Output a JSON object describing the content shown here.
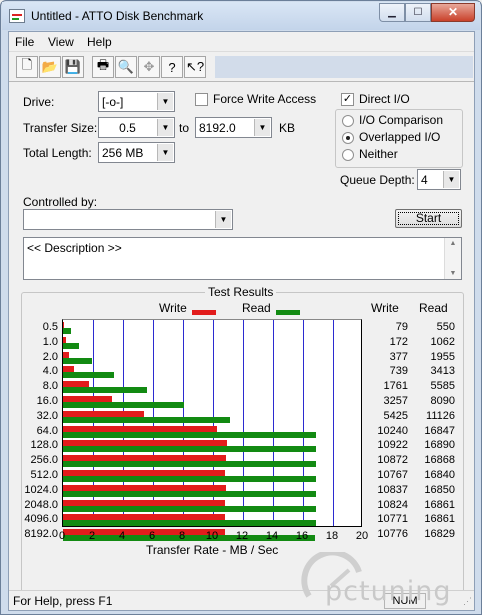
{
  "window": {
    "title": "Untitled - ATTO Disk Benchmark"
  },
  "menu": [
    "File",
    "View",
    "Help"
  ],
  "toolbar": {
    "icons": [
      "new-icon",
      "open-icon",
      "save-icon",
      "print-icon",
      "print-preview-icon",
      "move-icon",
      "help-icon",
      "context-help-icon"
    ]
  },
  "settings": {
    "drive_label": "Drive:",
    "drive_value": "[-o-]",
    "force_write_label": "Force Write Access",
    "force_write_checked": false,
    "direct_io_label": "Direct I/O",
    "direct_io_checked": true,
    "transfer_size_label": "Transfer Size:",
    "transfer_from": "0.5",
    "to_label": "to",
    "transfer_to": "8192.0",
    "unit_label": "KB",
    "total_length_label": "Total Length:",
    "total_length_value": "256 MB",
    "io_options": [
      {
        "label": "I/O Comparison",
        "selected": false
      },
      {
        "label": "Overlapped I/O",
        "selected": true
      },
      {
        "label": "Neither",
        "selected": false
      }
    ],
    "queue_depth_label": "Queue Depth:",
    "queue_depth_value": "4",
    "controlled_by_label": "Controlled by:",
    "controlled_by_value": "",
    "start_label": "Start",
    "description_text": "<< Description >>"
  },
  "results": {
    "group_title": "Test Results",
    "legend_write": "Write",
    "legend_read": "Read",
    "col_write": "Write",
    "col_read": "Read"
  },
  "chart_data": {
    "type": "bar",
    "xlabel": "Transfer Rate - MB / Sec",
    "xlim": [
      0,
      20
    ],
    "xticks": [
      "0",
      "2",
      "4",
      "6",
      "8",
      "10",
      "12",
      "14",
      "16",
      "18",
      "20"
    ],
    "categories": [
      "0.5",
      "1.0",
      "2.0",
      "4.0",
      "8.0",
      "16.0",
      "32.0",
      "64.0",
      "128.0",
      "256.0",
      "512.0",
      "1024.0",
      "2048.0",
      "4096.0",
      "8192.0"
    ],
    "series": [
      {
        "name": "Write",
        "color": "#e21c1c",
        "values": [
          0.079,
          0.172,
          0.377,
          0.739,
          1.761,
          3.257,
          5.425,
          10.24,
          10.922,
          10.872,
          10.767,
          10.837,
          10.824,
          10.771,
          10.776
        ]
      },
      {
        "name": "Read",
        "color": "#128a12",
        "values": [
          0.55,
          1.062,
          1.955,
          3.413,
          5.585,
          8.09,
          11.126,
          16.847,
          16.89,
          16.868,
          16.84,
          16.85,
          16.861,
          16.861,
          16.829
        ]
      }
    ],
    "write_numbers": [
      "79",
      "172",
      "377",
      "739",
      "1761",
      "3257",
      "5425",
      "10240",
      "10922",
      "10872",
      "10767",
      "10837",
      "10824",
      "10771",
      "10776"
    ],
    "read_numbers": [
      "550",
      "1062",
      "1955",
      "3413",
      "5585",
      "8090",
      "11126",
      "16847",
      "16890",
      "16868",
      "16840",
      "16850",
      "16861",
      "16861",
      "16829"
    ]
  },
  "status": {
    "help_text": "For Help, press F1",
    "num_indicator": "NUM"
  },
  "watermark": {
    "text": "pctuning"
  }
}
